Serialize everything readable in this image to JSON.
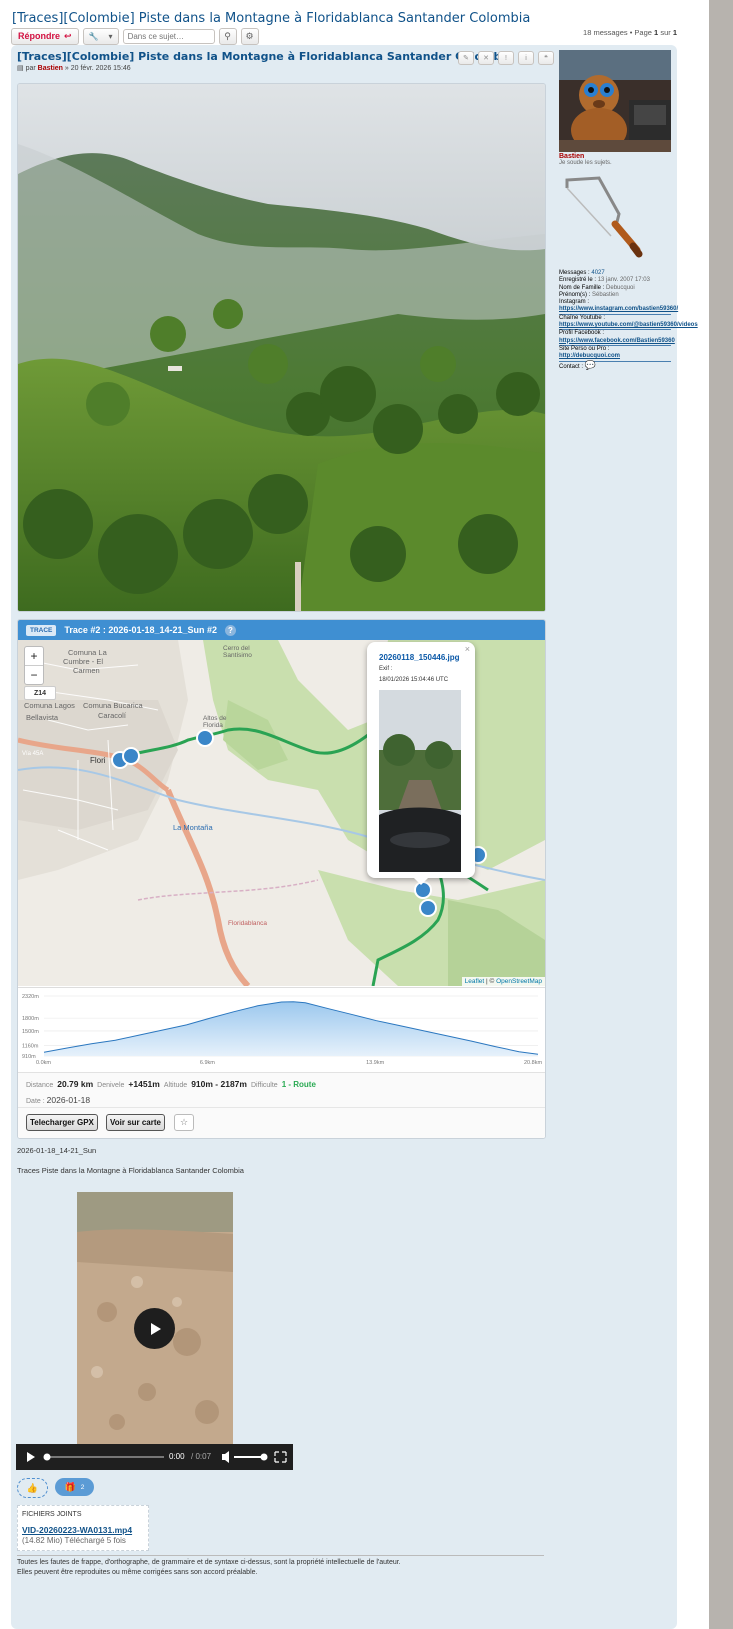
{
  "topic": {
    "title": "[Traces][Colombie] Piste dans la Montagne à Floridablanca Santander Colombia",
    "reply_label": "Répondre",
    "search_placeholder": "Dans ce sujet…",
    "pagination_prefix": "18 messages • Page",
    "page_current": "1",
    "page_of": "sur",
    "page_total": "1"
  },
  "post": {
    "title": "[Traces][Colombie] Piste dans la Montagne à Floridablanca Santander Colombia",
    "meta_prefix": "par",
    "author": "Bastien",
    "meta_date": "» 20 févr. 2026 15:46",
    "buttons": [
      "edit-icon",
      "delete-icon",
      "report-icon",
      "info-icon",
      "quote-icon"
    ]
  },
  "trace": {
    "badge": "TRACE",
    "title": "Trace #2 : 2026-01-18_14-21_Sun #2",
    "help": "?",
    "zoom_in": "+",
    "zoom_out": "−",
    "zoom_level": "Z14",
    "attribution_leaflet": "Leaflet",
    "attribution_sep": " | © ",
    "attribution_osm": "OpenStreetMap",
    "map_labels": {
      "comuna1": "Comuna La Cumbre - El Carmen",
      "lagos": "Comuna Lagos",
      "bellavista": "Bellavista",
      "bucarica": "Comuna Bucarica",
      "caracoli": "Caracolí",
      "flori": "Flori",
      "montana": "La Montaña",
      "via": "Vía 45A",
      "altos": "Altos de Florida",
      "cerro": "Cerro del Santísimo",
      "floridablanca": "Floridablanca"
    },
    "popup": {
      "title": "20260118_150446.jpg",
      "exif": "Exif :",
      "date": "18/01/2026 15:04:46 UTC",
      "close": "×"
    },
    "profile": {
      "y_labels": [
        "2320m",
        "1800m",
        "1500m",
        "1160m",
        "910m"
      ],
      "x_labels": [
        "0.0km",
        "6.9km",
        "13.9km",
        "20.8km"
      ]
    },
    "stats": {
      "distance_label": "Distance",
      "distance": "20.79 km",
      "denivele_label": "Denivele",
      "denivele": "+1451m",
      "altitude_label": "Altitude",
      "altitude": "910m - 2187m",
      "difficulte_label": "Difficulte",
      "difficulte": "1 - Route",
      "date_label": "Date :",
      "date": "2026-01-18"
    },
    "btn_gpx": "Telecharger GPX",
    "btn_map": "Voir sur carte",
    "btn_star": "☆"
  },
  "chart_data": {
    "type": "area",
    "title": "",
    "xlabel": "",
    "ylabel": "",
    "x": [
      0,
      1,
      2,
      3,
      4,
      5,
      6,
      7,
      8,
      9,
      10,
      10.5,
      11,
      12,
      13,
      14,
      15,
      16,
      17,
      18,
      19,
      20,
      20.8
    ],
    "y": [
      1000,
      1100,
      1200,
      1280,
      1400,
      1520,
      1640,
      1800,
      1950,
      2090,
      2180,
      2187,
      2160,
      2020,
      1880,
      1740,
      1620,
      1500,
      1380,
      1260,
      1130,
      1010,
      950
    ],
    "x_ticks": [
      "0.0km",
      "6.9km",
      "13.9km",
      "20.8km"
    ],
    "y_ticks": [
      "910m",
      "1160m",
      "1500m",
      "1800m",
      "2320m"
    ],
    "xlim": [
      0,
      20.8
    ],
    "ylim": [
      910,
      2320
    ],
    "colors": {
      "line": "#2b77bf",
      "fill": "#9cc8ee"
    }
  },
  "body": {
    "line1": "2026-01-18_14-21_Sun",
    "line2": "Traces Piste dans la Montagne à Floridablanca Santander Colombia"
  },
  "video": {
    "time": "0:00",
    "duration": "/ 0:07"
  },
  "reactions": {
    "like_icon": "👍",
    "gift_count": "2"
  },
  "attachments": {
    "header": "FICHIERS JOINTS",
    "file_name": "VID-20260223-WA0131.mp4",
    "file_meta": "(14.82 Mio) Téléchargé 5 fois"
  },
  "signature": {
    "line1": "Toutes les fautes de frappe, d'orthographe, de grammaire et de syntaxe ci-dessus, sont la propriété intellectuelle de l'auteur.",
    "line2": "Elles peuvent être reproduites ou même corrigées sans son accord préalable."
  },
  "sidebar": {
    "username": "Bastien",
    "rank": "Je soude les sujets.",
    "fields": [
      {
        "label": "Messages :",
        "value": "4027",
        "link": true
      },
      {
        "label": "Enregistré le :",
        "value": "13 janv. 2007 17:03",
        "link": false
      },
      {
        "label": "Nom de Famille :",
        "value": "Debucquoi",
        "link": false
      },
      {
        "label": "Prénom(s) :",
        "value": "Sébastien",
        "link": false
      }
    ],
    "instagram_label": "Instagram :",
    "instagram_url": "https://www.instagram.com/bastien59360/",
    "youtube_label": "Chaîne Youtube :",
    "youtube_url": "https://www.youtube.com/@bastien59360/videos",
    "facebook_label": "Profil Facebook :",
    "facebook_url": "https://www.facebook.com/Bastien59360",
    "site_label": "Site Perso ou Pro :",
    "site_url": "http://debucquoi.com",
    "contact_label": "Contact :"
  },
  "colors": {
    "post_bg": "#e1ebf2",
    "link": "#105289",
    "author": "#aa0000",
    "trace_header": "#3f8fd2",
    "route": "#2aa353"
  }
}
